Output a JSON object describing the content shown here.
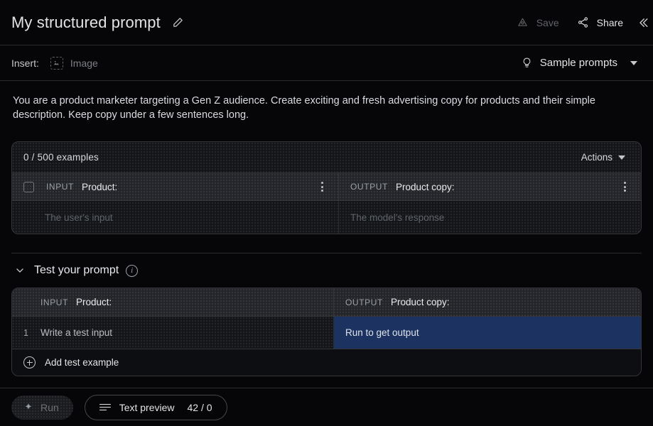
{
  "header": {
    "title": "My structured prompt",
    "edit_icon": "pencil-icon",
    "save_label": "Save",
    "save_icon": "drive-triangle-icon",
    "share_label": "Share",
    "share_icon": "share-nodes-icon",
    "panel_toggle_icon": "chevron-left-icon"
  },
  "insertbar": {
    "insert_label": "Insert:",
    "image_label": "Image",
    "image_icon": "image-icon",
    "sample_prompts_label": "Sample prompts",
    "sample_prompts_icon": "lightbulb-icon",
    "sample_prompts_caret": "caret-down-icon"
  },
  "prompt": {
    "text": "You are a product marketer targeting a Gen Z audience. Create exciting and fresh advertising copy for products and their simple description. Keep copy under a few sentences long."
  },
  "examples": {
    "count_label": "0 / 500 examples",
    "actions_label": "Actions",
    "actions_caret": "caret-down-icon",
    "input_tag": "INPUT",
    "input_column": "Product:",
    "output_tag": "OUTPUT",
    "output_column": "Product copy:",
    "input_placeholder": "The user's input",
    "output_placeholder": "The model's response"
  },
  "test": {
    "section_title": "Test your prompt",
    "collapse_icon": "chevron-down-icon",
    "info_icon": "info-circle-icon",
    "input_tag": "INPUT",
    "input_column": "Product:",
    "output_tag": "OUTPUT",
    "output_column": "Product copy:",
    "row_number": "1",
    "input_placeholder": "Write a test input",
    "output_placeholder": "Run to get output",
    "add_label": "Add test example",
    "add_icon": "plus-circle-icon",
    "highlight_color": "#1c3361"
  },
  "bottombar": {
    "run_label": "Run",
    "run_icon": "sparkle-icon",
    "preview_label": "Text preview",
    "preview_icon": "text-lines-icon",
    "token_count": "42 / 0"
  }
}
